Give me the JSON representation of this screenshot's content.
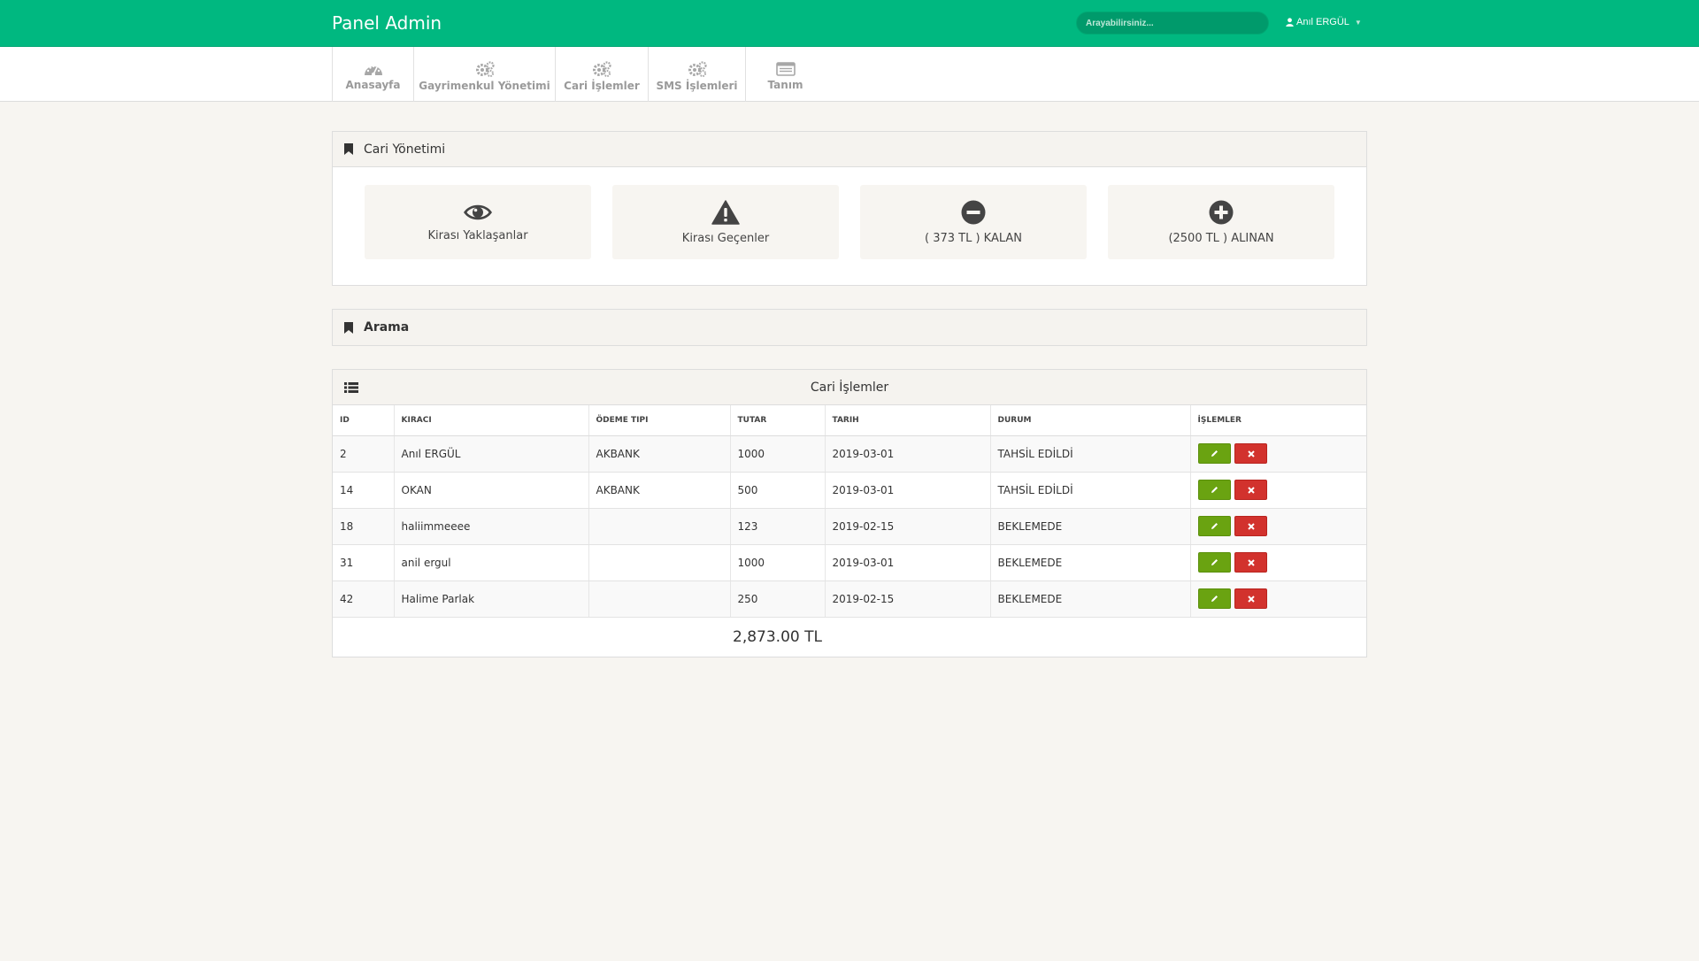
{
  "app": {
    "brand": "Panel Admin",
    "search_placeholder": "Arayabilirsiniz...",
    "user_name": "Anıl ERGÜL"
  },
  "nav": {
    "items": [
      {
        "label": "Anasayfa",
        "icon": "dashboard-icon"
      },
      {
        "label": "Gayrimenkul Yönetimi",
        "icon": "gears-icon"
      },
      {
        "label": "Cari İşlemler",
        "icon": "gears-icon"
      },
      {
        "label": "SMS İşlemleri",
        "icon": "gears-icon"
      },
      {
        "label": "Tanım",
        "icon": "list-box-icon"
      }
    ]
  },
  "cari_panel": {
    "title": "Cari Yönetimi",
    "tiles": [
      {
        "label": "Kirası Yaklaşanlar",
        "icon": "eye-icon"
      },
      {
        "label": "Kirası Geçenler",
        "icon": "warning-icon"
      },
      {
        "label": "( 373 TL ) KALAN",
        "icon": "minus-circle-icon"
      },
      {
        "label": "(2500 TL ) ALINAN",
        "icon": "plus-circle-icon"
      }
    ]
  },
  "search_panel": {
    "title": "Arama"
  },
  "table_panel": {
    "title": "Cari İşlemler",
    "columns": [
      "ID",
      "KIRACI",
      "ÖDEME TIPI",
      "TUTAR",
      "TARIH",
      "DURUM",
      "İŞLEMLER"
    ],
    "rows": [
      {
        "id": "2",
        "kiraci": "Anıl ERGÜL",
        "odeme": "AKBANK",
        "tutar": "1000",
        "tarih": "2019-03-01",
        "durum": "TAHSİL EDİLDİ"
      },
      {
        "id": "14",
        "kiraci": "OKAN",
        "odeme": "AKBANK",
        "tutar": "500",
        "tarih": "2019-03-01",
        "durum": "TAHSİL EDİLDİ"
      },
      {
        "id": "18",
        "kiraci": "haliimmeeee",
        "odeme": "",
        "tutar": "123",
        "tarih": "2019-02-15",
        "durum": "BEKLEMEDE"
      },
      {
        "id": "31",
        "kiraci": "anil ergul",
        "odeme": "",
        "tutar": "1000",
        "tarih": "2019-03-01",
        "durum": "BEKLEMEDE"
      },
      {
        "id": "42",
        "kiraci": "Halime Parlak",
        "odeme": "",
        "tutar": "250",
        "tarih": "2019-02-15",
        "durum": "BEKLEMEDE"
      }
    ],
    "total": "2,873.00 TL"
  },
  "colors": {
    "brand_green": "#00b880",
    "edit_green": "#6aa311",
    "delete_red": "#d2322d",
    "page_bg": "#f7f5f1"
  }
}
